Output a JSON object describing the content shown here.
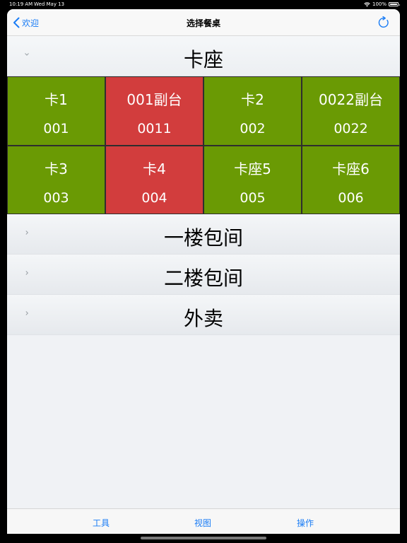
{
  "status_bar": {
    "time": "10:19 AM",
    "date": "Wed May 13",
    "battery": "100%"
  },
  "nav": {
    "back_label": "欢迎",
    "title": "选择餐桌"
  },
  "sections": [
    {
      "title": "卡座",
      "expanded": true,
      "tables": [
        {
          "name": "卡1",
          "code": "001",
          "status": "green"
        },
        {
          "name": "001副台",
          "code": "0011",
          "status": "red"
        },
        {
          "name": "卡2",
          "code": "002",
          "status": "green"
        },
        {
          "name": "0022副台",
          "code": "0022",
          "status": "green"
        },
        {
          "name": "卡3",
          "code": "003",
          "status": "green"
        },
        {
          "name": "卡4",
          "code": "004",
          "status": "red"
        },
        {
          "name": "卡座5",
          "code": "005",
          "status": "green"
        },
        {
          "name": "卡座6",
          "code": "006",
          "status": "green"
        }
      ]
    },
    {
      "title": "一楼包间",
      "expanded": false
    },
    {
      "title": "二楼包间",
      "expanded": false
    },
    {
      "title": "外卖",
      "expanded": false
    }
  ],
  "tab_bar": {
    "tools": "工具",
    "view": "视图",
    "operate": "操作"
  },
  "colors": {
    "accent": "#1a7cf5",
    "table_available": "#6a9a04",
    "table_occupied": "#d23d3d"
  }
}
